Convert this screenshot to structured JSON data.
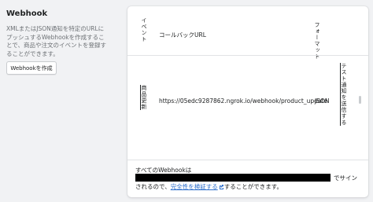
{
  "left": {
    "title": "Webhook",
    "description": "XMLまたはJSON通知を特定のURLにプッシュするWebhookを作成することで、商品や注文のイベントを登録することができます。",
    "create_button": "Webhookを作成"
  },
  "table": {
    "headers": {
      "event": "イベント",
      "callback_url": "コールバックURL",
      "format": "フォーマット"
    },
    "rows": [
      {
        "event": "商品更新",
        "callback_url": "https://05edc9287862.ngrok.io/webhook/product_update",
        "format": "JSON",
        "action": "テスト通知を送信する"
      }
    ]
  },
  "footer": {
    "line1_prefix": "すべてのWebhookは",
    "line1_suffix": "でサイン",
    "line2_prefix": "されるので、",
    "verify_link": "完全性を検証する",
    "line2_suffix": "することができます。"
  },
  "colors": {
    "link": "#2c6ecb",
    "background": "#f1f2f4",
    "card": "#ffffff"
  }
}
